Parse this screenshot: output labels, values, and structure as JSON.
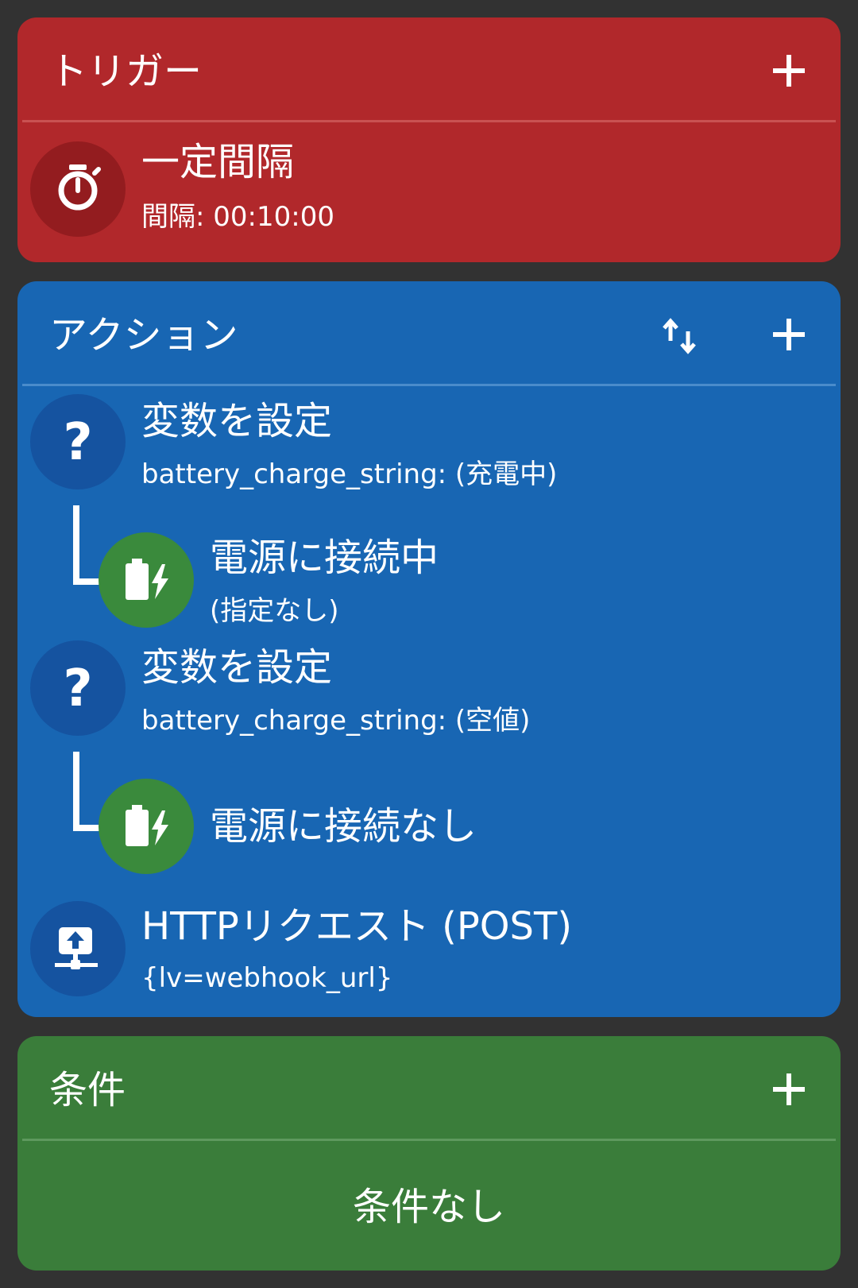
{
  "trigger": {
    "title": "トリガー",
    "items": [
      {
        "title": "一定間隔",
        "subtitle": "間隔: 00:10:00",
        "icon": "stopwatch-icon"
      }
    ]
  },
  "action": {
    "title": "アクション",
    "items": [
      {
        "title": "変数を設定",
        "subtitle": "battery_charge_string: (充電中)",
        "icon": "question-icon",
        "constraint": {
          "title": "電源に接続中",
          "subtitle": "(指定なし)",
          "icon": "battery-charging-icon"
        }
      },
      {
        "title": "変数を設定",
        "subtitle": "battery_charge_string: (空値)",
        "icon": "question-icon",
        "constraint": {
          "title": "電源に接続なし",
          "icon": "battery-charging-icon"
        }
      },
      {
        "title": "HTTPリクエスト (POST)",
        "subtitle": "{lv=webhook_url}",
        "icon": "network-upload-icon"
      }
    ]
  },
  "condition": {
    "title": "条件",
    "empty_label": "条件なし"
  },
  "colors": {
    "trigger": "#B1282B",
    "action": "#1866B3",
    "condition": "#3A7D3A",
    "background": "#323232"
  }
}
